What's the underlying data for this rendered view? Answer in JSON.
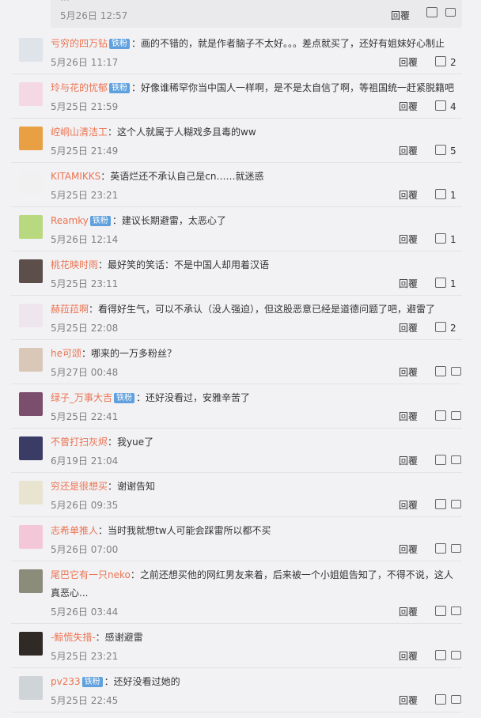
{
  "top_partial": {
    "text": "…",
    "time": "5月26日 12:57",
    "reply": "回覆",
    "like_icon": "thumbs-up-icon",
    "comment_icon": "comment-icon"
  },
  "colors": {
    "username": "#eb7350",
    "badge": "#5fa0dd",
    "vip": "#f1a800",
    "level": "#f36b2d"
  },
  "comments": [
    {
      "user": "亏穷的四万钻",
      "badge": "铁粉",
      "text": "：画的不错的，就是作者脑子不太好。。。差点就买了，还好有姐妹好心制止",
      "time": "5月26日 11:17",
      "reply": "回覆",
      "likes": "2"
    },
    {
      "user": "玲与花的忧郁",
      "badge": "铁粉",
      "text": "：好像谁稀罕你当中国人一样啊，是不是太自信了啊，等祖国统一赶紧脱籍吧",
      "time": "5月25日 21:59",
      "reply": "回覆",
      "likes": "4"
    },
    {
      "user": "崆峒山清洁工",
      "badge": "",
      "text": "：这个人就属于人糊戏多且毒的ww",
      "time": "5月25日 21:49",
      "reply": "回覆",
      "likes": "5"
    },
    {
      "user": "KITAMIKKS",
      "badge": "",
      "text": "：英语烂还不承认自己是cn……就迷惑",
      "time": "5月25日 23:21",
      "reply": "回覆",
      "likes": "1"
    },
    {
      "user": "Reamky",
      "badge": "铁粉",
      "text": "：建议长期避雷，太恶心了",
      "time": "5月26日 12:14",
      "reply": "回覆",
      "likes": "1"
    },
    {
      "user": "桃花映时雨",
      "badge": "",
      "text": "：最好笑的笑话：不是中国人却用着汉语",
      "time": "5月25日 23:11",
      "reply": "回覆",
      "likes": "1"
    },
    {
      "user": "赫菈菈啊",
      "badge": "",
      "text": "：看得好生气，可以不承认（没人强迫），但这股恶意已经是道德问题了吧，避雷了",
      "time": "5月25日 22:08",
      "reply": "回覆",
      "likes": "2"
    },
    {
      "user": "he可颂",
      "badge": "",
      "text": "：哪来的一万多粉丝？",
      "time": "5月27日 00:48",
      "reply": "回覆",
      "likes": ""
    },
    {
      "user": "绿子_万事大吉",
      "badge": "铁粉",
      "text": "：还好没看过，安雅辛苦了",
      "time": "5月25日 22:41",
      "reply": "回覆",
      "likes": ""
    },
    {
      "user": "不曾打扫灰烬",
      "badge": "",
      "text": "：我yue了",
      "time": "6月19日 21:04",
      "reply": "回覆",
      "likes": ""
    },
    {
      "user": "穷还是很想买",
      "badge": "",
      "text": "：谢谢告知",
      "time": "5月26日 09:35",
      "reply": "回覆",
      "likes": ""
    },
    {
      "user": "志希单推人",
      "badge": "",
      "text": "：当时我就想tw人可能会踩雷所以都不买",
      "time": "5月26日 07:00",
      "reply": "回覆",
      "likes": ""
    },
    {
      "user": "尾巴它有一只neko",
      "badge": "",
      "text": "：之前还想买他的网红男友来着，后来被一个小姐姐告知了，不得不说，这人真恶心...",
      "time": "5月26日 03:44",
      "reply": "回覆",
      "likes": ""
    },
    {
      "user": "-鲸慌失措-",
      "badge": "",
      "text": "：感谢避雷",
      "time": "5月25日 23:21",
      "reply": "回覆",
      "likes": ""
    },
    {
      "user": "pv233",
      "badge": "铁粉",
      "text": "：还好没看过她的",
      "time": "5月25日 22:45",
      "reply": "回覆",
      "likes": ""
    }
  ]
}
